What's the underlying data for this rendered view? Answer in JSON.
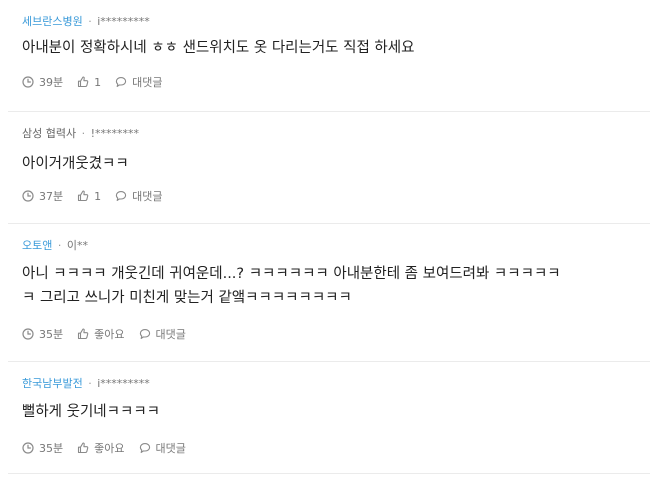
{
  "comments": [
    {
      "company": "세브란스병원",
      "separator": "·",
      "nickname": "i*********",
      "text_lines": [
        "아내분이 정확하시네 ㅎㅎ 샌드위치도 옷 다리는거도 직접 하세요"
      ],
      "time": "39분",
      "likes": "1",
      "reply_label": "대댓글"
    },
    {
      "company": "삼성 협력사",
      "separator": "·",
      "nickname": "!********",
      "text_lines": [
        "아이거개웃겼ㅋㅋ"
      ],
      "time": "37분",
      "likes": "1",
      "reply_label": "대댓글"
    },
    {
      "company": "오토앤",
      "separator": "·",
      "nickname": "이**",
      "text_lines": [
        "아니 ㅋㅋㅋㅋ 개웃긴데 귀여운데...? ㅋㅋㅋㅋㅋㅋ 아내분한테 좀 보여드려봐 ㅋㅋㅋㅋㅋ",
        "ㅋ 그리고 쓰니가 미친게 맞는거 같앸ㅋㅋㅋㅋㅋㅋㅋㅋ"
      ],
      "time": "35분",
      "likes": "좋아요",
      "reply_label": "대댓글"
    },
    {
      "company": "한국남부발전",
      "separator": "·",
      "nickname": "i*********",
      "text_lines": [
        "뻘하게 웃기네ㅋㅋㅋㅋ"
      ],
      "time": "35분",
      "likes": "좋아요",
      "reply_label": "대댓글"
    }
  ],
  "colors": {
    "company_link": "#3a9ad9",
    "company_plain": "#666666",
    "meta_gray": "#777777",
    "divider": "#ebebeb"
  },
  "icons": {
    "time": "clock-icon",
    "like": "thumbs-up-icon",
    "reply": "speech-bubble-icon"
  }
}
